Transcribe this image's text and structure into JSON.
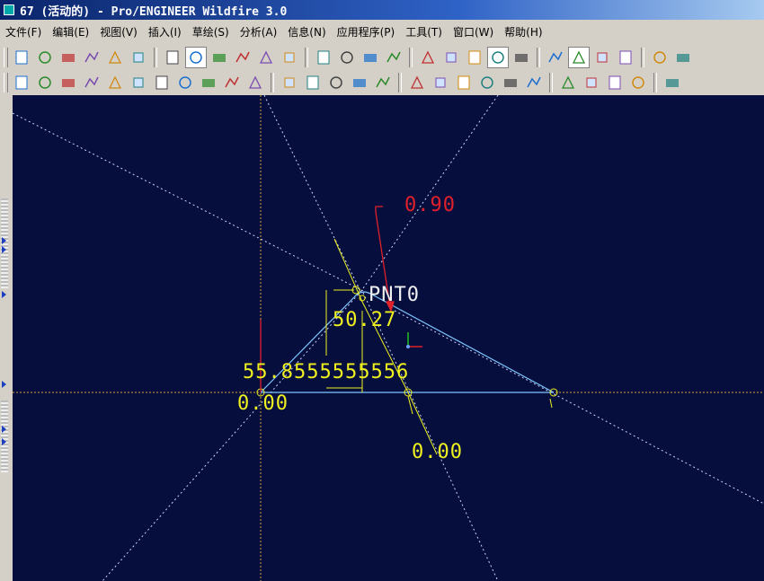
{
  "window": {
    "title": "67 (活动的) - Pro/ENGINEER Wildfire 3.0",
    "accent": "#0a246a",
    "canvas_bg": "#050e3d"
  },
  "menu": [
    {
      "label": "文件(F)"
    },
    {
      "label": "编辑(E)"
    },
    {
      "label": "视图(V)"
    },
    {
      "label": "插入(I)"
    },
    {
      "label": "草绘(S)"
    },
    {
      "label": "分析(A)"
    },
    {
      "label": "信息(N)"
    },
    {
      "label": "应用程序(P)"
    },
    {
      "label": "工具(T)"
    },
    {
      "label": "窗口(W)"
    },
    {
      "label": "帮助(H)"
    }
  ],
  "toolbar_top": [
    "new-file-icon",
    "open-file-icon",
    "save-icon",
    "print-icon",
    "email-icon",
    "send-icon",
    "sketch-repaint-icon",
    "select-sketch-icon",
    "zoom-fit-icon",
    "zoom-in-icon",
    "zoom-out-icon",
    "refit-icon",
    "orient-icon",
    "view-list-icon",
    "layer-icon",
    "saved-views-icon",
    "wireframe-icon",
    "hidden-line-icon",
    "no-hidden-icon",
    "shading-icon",
    "model-tree-icon",
    "datum-plane-icon",
    "datum-axis-icon",
    "datum-point-icon",
    "coord-sys-icon",
    "toggle-dimension-icon",
    "toggle-constraint-icon"
  ],
  "toolbar_bottom": [
    "measure-icon",
    "area-icon",
    "diameter-icon",
    "angle-icon",
    "curve-analysis-icon",
    "surface-analysis-icon",
    "curvature-icon",
    "shading-analysis-icon",
    "draft-icon",
    "dimension-icon",
    "slope-icon",
    "param-icon",
    "relation-icon",
    "dim-switch-icon",
    "info-icon",
    "model-player-icon",
    "family-table-icon",
    "program-icon",
    "render-icon",
    "camera-icon",
    "annotation-icon",
    "bom-icon",
    "window-icon",
    "check-icon",
    "close-window-icon",
    "smiley-icon",
    "help-context-icon"
  ],
  "drawing": {
    "dim_top": "0.90",
    "dim_bottom": "0.00",
    "dim_height": "50.27",
    "dim_length": "55.8555555556",
    "dim_left": "0.00",
    "point_label": "PNT0"
  }
}
